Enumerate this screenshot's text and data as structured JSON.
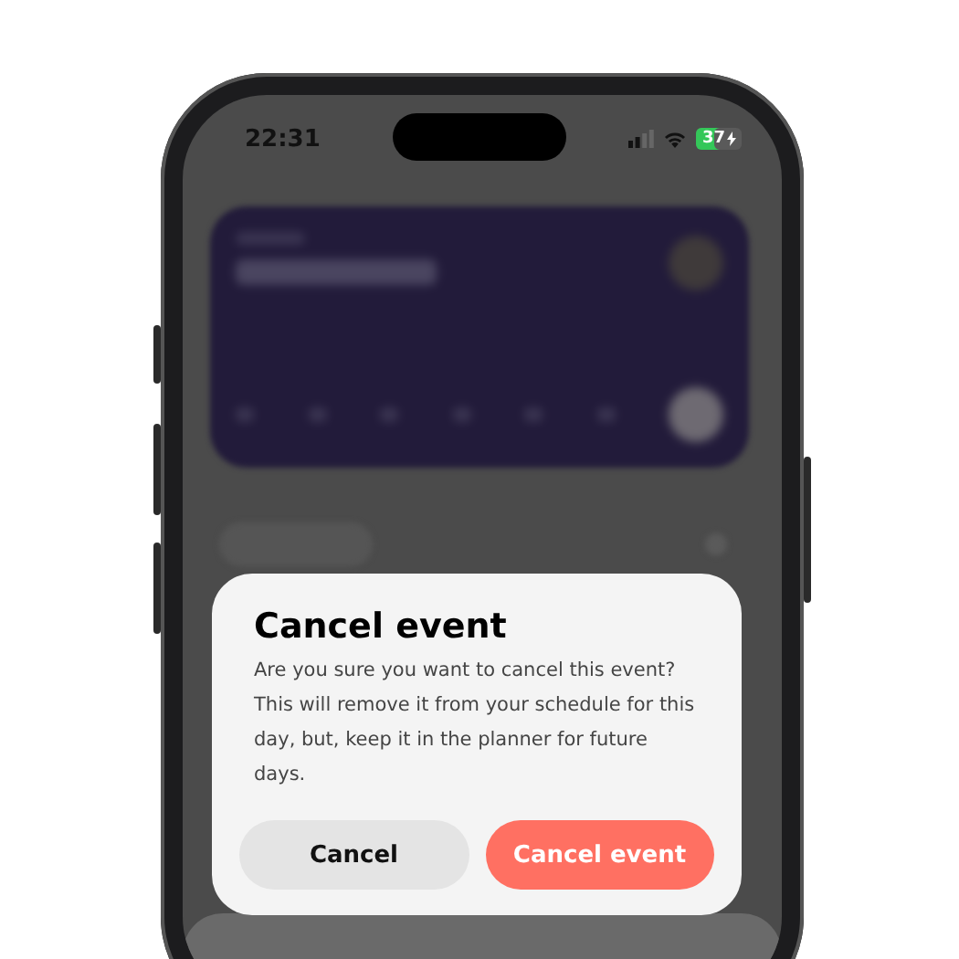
{
  "status_bar": {
    "time": "22:31",
    "battery": "37"
  },
  "dialog": {
    "title": "Cancel event",
    "message": "Are you sure you want to cancel this event? This will remove it from your schedule for this day, but, keep it in the planner for future days.",
    "buttons": [
      {
        "label": "Cancel",
        "kind": "secondary"
      },
      {
        "label": "Cancel event",
        "kind": "destructive"
      }
    ]
  }
}
